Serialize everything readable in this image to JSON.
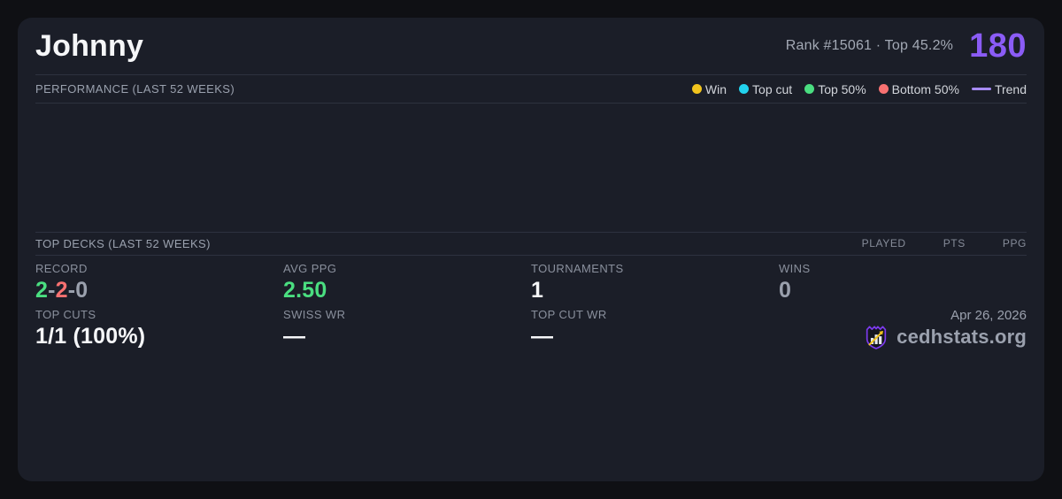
{
  "colors": {
    "accent_purple": "#8b5cf6",
    "trend_purple": "#a78bfa",
    "win_yellow": "#f2c41d",
    "top_cut_cyan": "#22d3ee",
    "top50_green": "#4ade80",
    "bottom50_red": "#f87171",
    "value_white": "#f5f6f8",
    "value_gray": "#9aa0ad",
    "card_bg": "#1b1e28",
    "page_bg": "#0f1014"
  },
  "header": {
    "player_name": "Johnny",
    "rank_summary": "Rank #15061  ·  Top 45.2%",
    "rating": "180"
  },
  "performance": {
    "title": "PERFORMANCE (LAST 52 WEEKS)",
    "legend": [
      {
        "label": "Win",
        "color": "#f2c41d"
      },
      {
        "label": "Top cut",
        "color": "#22d3ee"
      },
      {
        "label": "Top 50%",
        "color": "#4ade80"
      },
      {
        "label": "Bottom 50%",
        "color": "#f87171"
      },
      {
        "label": "Trend",
        "color": "#a78bfa"
      }
    ]
  },
  "chart_data": {
    "type": "scatter",
    "title": "PERFORMANCE (LAST 52 WEEKS)",
    "x": [],
    "series": [
      {
        "name": "Win",
        "points": []
      },
      {
        "name": "Top cut",
        "points": []
      },
      {
        "name": "Top 50%",
        "points": []
      },
      {
        "name": "Bottom 50%",
        "points": []
      },
      {
        "name": "Trend",
        "points": []
      }
    ],
    "note": "chart plot area is rendered empty — no data points visible"
  },
  "top_decks": {
    "title": "TOP DECKS (LAST 52 WEEKS)",
    "columns": [
      "PLAYED",
      "PTS",
      "PPG"
    ],
    "rows": []
  },
  "stats": {
    "record": {
      "label": "RECORD",
      "parts": [
        {
          "text": "2",
          "color": "#4ade80"
        },
        {
          "text": "-",
          "color": "#9aa0ad"
        },
        {
          "text": "2",
          "color": "#f87171"
        },
        {
          "text": "-",
          "color": "#9aa0ad"
        },
        {
          "text": "0",
          "color": "#9aa0ad"
        }
      ]
    },
    "avg_ppg": {
      "label": "AVG PPG",
      "value": "2.50",
      "color": "#4ade80"
    },
    "tournaments": {
      "label": "TOURNAMENTS",
      "value": "1",
      "color": "#f5f6f8"
    },
    "wins": {
      "label": "WINS",
      "value": "0",
      "color": "#9aa0ad"
    },
    "top_cuts": {
      "label": "TOP CUTS",
      "value": "1/1 (100%)",
      "color": "#f5f6f8"
    },
    "swiss_wr": {
      "label": "SWISS WR",
      "value": "—",
      "color": "#f5f6f8"
    },
    "top_cut_wr": {
      "label": "TOP CUT WR",
      "value": "—",
      "color": "#f5f6f8"
    }
  },
  "footer": {
    "date": "Apr 26, 2026",
    "site_name": "cedhstats.org"
  }
}
